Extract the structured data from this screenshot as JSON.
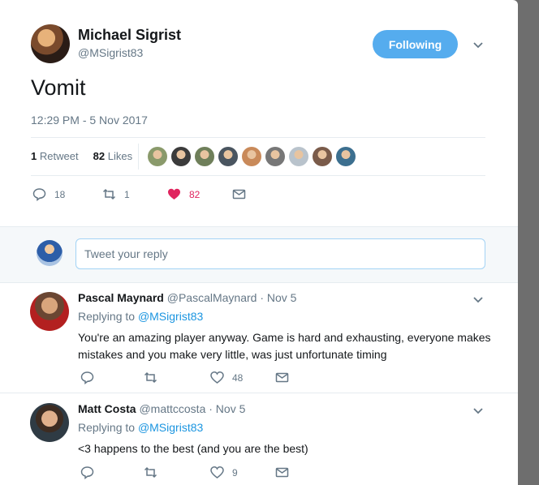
{
  "tweet": {
    "author_name": "Michael Sigrist",
    "author_handle": "@MSigrist83",
    "follow_label": "Following",
    "text": "Vomit",
    "timestamp": "12:29 PM - 5 Nov 2017",
    "retweets_count": "1",
    "retweets_label": "Retweet",
    "likes_count": "82",
    "likes_label": "Likes",
    "liker_colors": [
      "#8a9a6b",
      "#3b3b3b",
      "#6f7f5a",
      "#4a5560",
      "#c98a5a",
      "#777777",
      "#b9c3cc",
      "#7a5b4a",
      "#3c6f8f"
    ],
    "actions": {
      "reply_count": "18",
      "retweet_count": "1",
      "like_count": "82"
    }
  },
  "reply_box": {
    "placeholder": "Tweet your reply"
  },
  "replies": [
    {
      "name": "Pascal Maynard",
      "handle": "@PascalMaynard",
      "date": "· Nov 5",
      "replying_prefix": "Replying to",
      "replying_to": "@MSigrist83",
      "text": "You're an amazing player anyway. Game is hard and exhausting, everyone makes mistakes and you make very little, was just unfortunate timing",
      "like_count": "48"
    },
    {
      "name": "Matt Costa",
      "handle": "@mattccosta",
      "date": "· Nov 5",
      "replying_prefix": "Replying to",
      "replying_to": "@MSigrist83",
      "text": "<3 happens to the best (and you are the best)",
      "like_count": "9"
    }
  ],
  "colors": {
    "accent": "#55acee",
    "like": "#e0245e",
    "muted": "#657786",
    "link": "#1b95e0"
  }
}
